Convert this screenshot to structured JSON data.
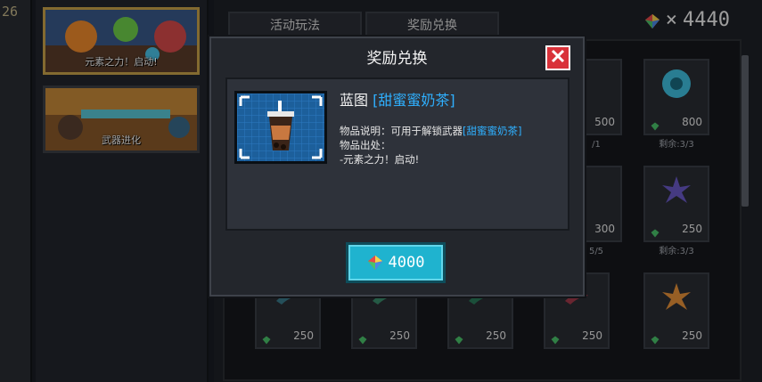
{
  "left_strip": {
    "number_fragment": "26"
  },
  "events": [
    {
      "title": "元素之力！启动!",
      "active": true
    },
    {
      "title": "武器进化",
      "active": false
    }
  ],
  "tabs": [
    {
      "label": "活动玩法"
    },
    {
      "label": "奖励兑换"
    }
  ],
  "currency": {
    "symbol": "×",
    "amount": "4440"
  },
  "shop_items": [
    {
      "price": "800",
      "remaining": "剩余:3/3",
      "icon": "gear-disc-icon"
    },
    {
      "price": "250",
      "remaining": "剩余:3/3",
      "icon": "spiky-star-icon"
    },
    {
      "price": "250",
      "remaining": "",
      "icon": "fire-star-icon"
    },
    {
      "price": "250",
      "remaining": "",
      "icon": "leaf-icon"
    },
    {
      "price": "250",
      "remaining": "",
      "icon": "leaf-icon"
    },
    {
      "price": "250",
      "remaining": "",
      "icon": "leaf-icon"
    },
    {
      "price": "250",
      "remaining": "",
      "icon": "leaf-icon"
    }
  ],
  "partial_items": [
    {
      "price": "500",
      "remaining": "/1"
    },
    {
      "price": "300",
      "remaining": "5/5"
    }
  ],
  "modal": {
    "title": "奖励兑换",
    "item_type": "蓝图",
    "item_name": "[甜蜜蜜奶茶]",
    "desc_label": "物品说明：可用于解锁武器",
    "desc_item": "[甜蜜蜜奶茶]",
    "source_label": "物品出处：",
    "source_value": "-元素之力！启动!",
    "buy_price": "4000"
  },
  "colors": {
    "accent_cyan": "#1fb3cf",
    "highlight_blue": "#2fb0ff",
    "close_red": "#d9323a"
  }
}
